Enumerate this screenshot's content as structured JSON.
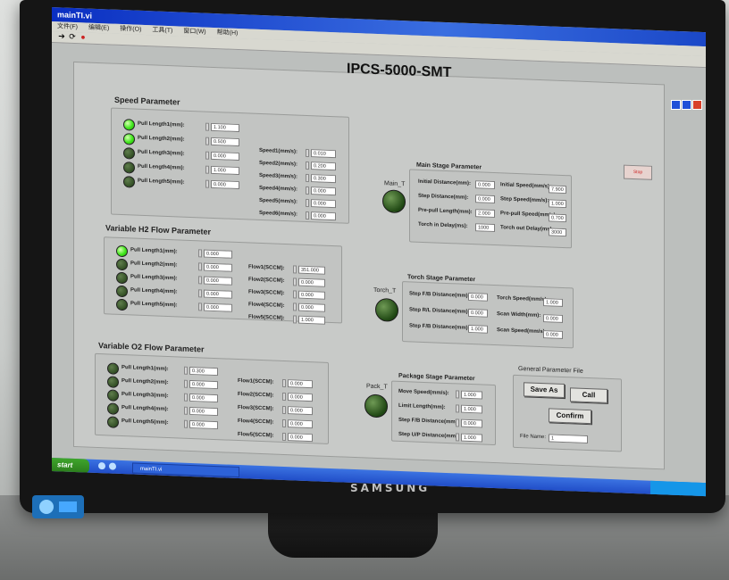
{
  "window": {
    "title": "mainTI.vi"
  },
  "menu": [
    "文件(F)",
    "编辑(E)",
    "操作(O)",
    "工具(T)",
    "窗口(W)",
    "帮助(H)"
  ],
  "app_title": "IPCS-5000-SMT",
  "speed_parameter": {
    "title": "Speed Parameter",
    "lengths": [
      {
        "label": "Pull Length1(mm):",
        "value": "1.100",
        "lamp": "on"
      },
      {
        "label": "Pull Length2(mm):",
        "value": "0.500",
        "lamp": "on"
      },
      {
        "label": "Pull Length3(mm):",
        "value": "0.000",
        "lamp": "off"
      },
      {
        "label": "Pull Length4(mm):",
        "value": "1.000",
        "lamp": "off"
      },
      {
        "label": "Pull Length5(mm):",
        "value": "0.000",
        "lamp": "off"
      }
    ],
    "speeds": [
      {
        "label": "Speed1(mm/s):",
        "value": "0.010"
      },
      {
        "label": "Speed2(mm/s):",
        "value": "0.200"
      },
      {
        "label": "Speed3(mm/s):",
        "value": "0.300"
      },
      {
        "label": "Speed4(mm/s):",
        "value": "0.000"
      },
      {
        "label": "Speed5(mm/s):",
        "value": "0.000"
      },
      {
        "label": "Speed6(mm/s):",
        "value": "0.000"
      }
    ]
  },
  "h2_flow": {
    "title": "Variable H2 Flow Parameter",
    "lengths": [
      {
        "label": "Pull Length1(mm):",
        "value": "0.000",
        "lamp": "on"
      },
      {
        "label": "Pull Length2(mm):",
        "value": "0.000",
        "lamp": "off"
      },
      {
        "label": "Pull Length3(mm):",
        "value": "0.000",
        "lamp": "off"
      },
      {
        "label": "Pull Length4(mm):",
        "value": "0.000",
        "lamp": "off"
      },
      {
        "label": "Pull Length5(mm):",
        "value": "0.000",
        "lamp": "off"
      }
    ],
    "flows": [
      {
        "label": "Flow1(SCCM):",
        "value": "351.000"
      },
      {
        "label": "Flow2(SCCM):",
        "value": "0.000"
      },
      {
        "label": "Flow3(SCCM):",
        "value": "0.000"
      },
      {
        "label": "Flow4(SCCM):",
        "value": "0.000"
      },
      {
        "label": "Flow5(SCCM):",
        "value": "1.000"
      }
    ]
  },
  "o2_flow": {
    "title": "Variable O2 Flow Parameter",
    "lengths": [
      {
        "label": "Pull Length1(mm):",
        "value": "0.300",
        "lamp": "off"
      },
      {
        "label": "Pull Length2(mm):",
        "value": "0.000",
        "lamp": "off"
      },
      {
        "label": "Pull Length3(mm):",
        "value": "0.000",
        "lamp": "off"
      },
      {
        "label": "Pull Length4(mm):",
        "value": "0.000",
        "lamp": "off"
      },
      {
        "label": "Pull Length5(mm):",
        "value": "0.000",
        "lamp": "off"
      }
    ],
    "flows": [
      {
        "label": "Flow1(SCCM):",
        "value": "0.000"
      },
      {
        "label": "Flow2(SCCM):",
        "value": "0.000"
      },
      {
        "label": "Flow3(SCCM):",
        "value": "0.000"
      },
      {
        "label": "Flow4(SCCM):",
        "value": "0.000"
      },
      {
        "label": "Flow5(SCCM):",
        "value": "0.000"
      }
    ]
  },
  "main_stage": {
    "title": "Main Stage Parameter",
    "indicator_label": "Main_T",
    "rows": [
      {
        "label": "Initial Distance(mm):",
        "value": "0.000",
        "label2": "Initial Speed(mm/s):",
        "value2": "7.900"
      },
      {
        "label": "Step Distance(mm):",
        "value": "0.000",
        "label2": "Step Speed(mm/s):",
        "value2": "1.000"
      },
      {
        "label": "Pre-pull Length(mm):",
        "value": "2.000",
        "label2": "Pre-pull Speed(mm/s):",
        "value2": "0.700"
      },
      {
        "label": "Torch in Delay(ms):",
        "value": "1000",
        "label2": "Torch out Delay(ms):",
        "value2": "3000"
      }
    ]
  },
  "torch_stage": {
    "title": "Torch Stage Parameter",
    "indicator_label": "Torch_T",
    "rows": [
      {
        "label": "Step F/B Distance(mm):",
        "value": "0.000",
        "label2": "Torch Speed(mm/s):",
        "value2": "1.000"
      },
      {
        "label": "Step R/L Distance(mm):",
        "value": "0.000",
        "label2": "Scan Width(mm):",
        "value2": "0.000"
      },
      {
        "label": "Step F/B Distance(mm):",
        "value": "1.000",
        "label2": "Scan Speed(mm/s):",
        "value2": "0.000"
      }
    ]
  },
  "package_stage": {
    "title": "Package Stage Parameter",
    "indicator_label": "Pack_T",
    "rows": [
      {
        "label": "Move Speed(mm/s):",
        "value": "1.000"
      },
      {
        "label": "Limit Length(mm):",
        "value": "1.000"
      },
      {
        "label": "Step F/B Distance(mm):",
        "value": "0.000"
      },
      {
        "label": "Step U/P Distance(mm):",
        "value": "1.000"
      }
    ]
  },
  "general": {
    "title": "General Parameter File",
    "save_as": "Save As",
    "call": "Call",
    "confirm": "Confirm",
    "file_name_label": "File Name:",
    "file_name_value": "1"
  },
  "stop_button": "Stop",
  "taskbar": {
    "start": "start",
    "task": "mainTI.vi",
    "time": ""
  },
  "monitor": {
    "brand": "SAMSUNG"
  }
}
